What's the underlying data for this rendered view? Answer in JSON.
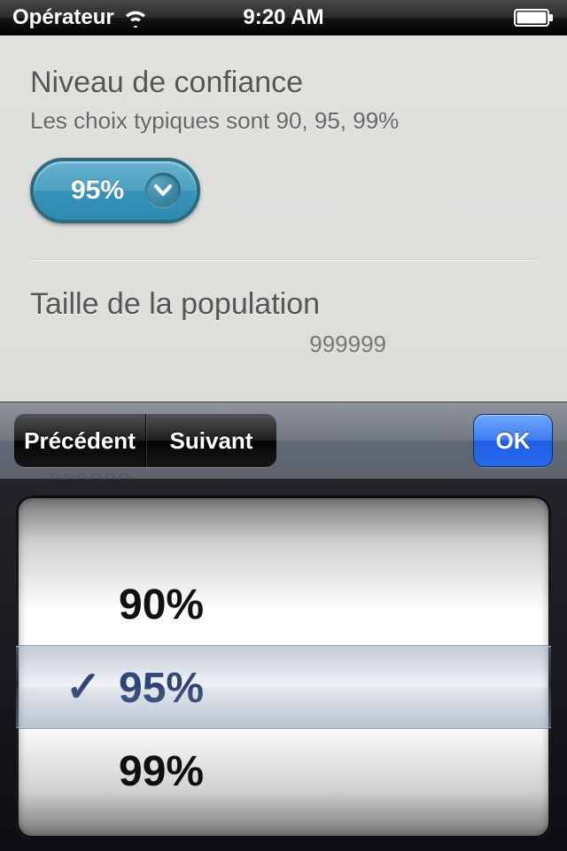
{
  "status_bar": {
    "carrier": "Opérateur",
    "time": "9:20 AM"
  },
  "confidence": {
    "title": "Niveau de confiance",
    "subtitle": "Les choix typiques sont 90, 95, 99%",
    "selected": "95%"
  },
  "population": {
    "title": "Taille de la population",
    "hint_value": "999999",
    "input_value": "999999"
  },
  "accessory": {
    "prev": "Précédent",
    "next": "Suivant",
    "ok": "OK"
  },
  "picker": {
    "options": [
      "90%",
      "95%",
      "99%"
    ],
    "selected_index": 1,
    "checkmark": "✓"
  }
}
